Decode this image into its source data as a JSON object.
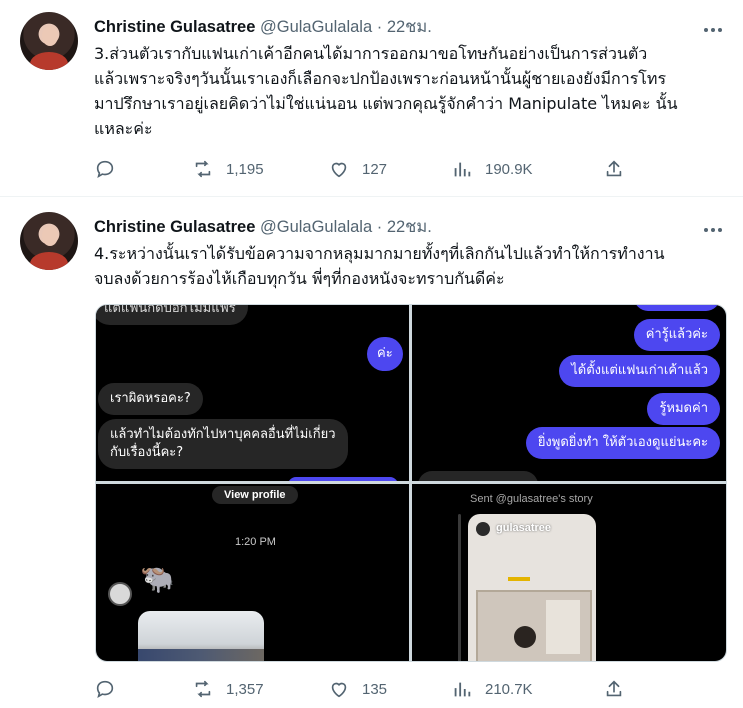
{
  "tweets": [
    {
      "name": "Christine Gulasatree",
      "handle": "@GulaGulalala",
      "separator": "·",
      "time": "22ชม.",
      "text_lines": [
        "3.ส่วนตัวเรากับแฟนเก่าเค้าอีกคนได้มาการออกมาขอโทษกันอย่างเป็นการส่วนตัว",
        "แล้วเพราะจริงๆวันนั้นเราเองก็เลือกจะปกป้องเพราะก่อนหน้านั้นผู้ชายเองยังมีการโทร",
        "มาปรึกษาเราอยู่เลยคิดว่าไม่ใช่แน่นอน แต่พวกคุณรู้จักคำว่า Manipulate ไหมคะ นั้น",
        "แหละค่ะ"
      ],
      "retweets": "1,195",
      "likes": "127",
      "views": "190.9K"
    },
    {
      "name": "Christine Gulasatree",
      "handle": "@GulaGulalala",
      "separator": "·",
      "time": "22ชม.",
      "text_lines": [
        "4.ระหว่างนั้นเราได้รับข้อความจากหลุมมากมายทั้งๆที่เลิกกันไปแล้วทำให้การทำงาน",
        "จบลงด้วยการร้องไห้เกือบทุกวัน พี่ๆที่กองหนังจะทราบกันดีค่ะ"
      ],
      "retweets": "1,357",
      "likes": "135",
      "views": "210.7K",
      "media": {
        "chat_left": {
          "cut_top": "แต่แฟนกัดบอกไม่มีแฟร",
          "out_1": "ค่ะ",
          "in_1": "เราผิดหรอคะ?",
          "in_2a": "แล้วทำไมต้องทักไปหาบุคคลอื่นที่ไม่เกี่ยว",
          "in_2b": "กับเรื่องนี้คะ?"
        },
        "chat_right": {
          "out_1": "ค่ารู้แล้วค่ะ",
          "out_2": "ได้ตั้งแต่แฟนเก่าเค้าแล้ว",
          "out_3": "รู้หมดค่า",
          "out_4": "ยิ่งพูดยิ่งทำ ให้ตัวเองดูแย่นะคะ"
        },
        "bottom_left": {
          "view_profile": "View profile",
          "time": "1:20 PM"
        },
        "bottom_right": {
          "sent_story": "Sent @gulasatree's story",
          "story_user": "gulasatree"
        }
      }
    }
  ]
}
